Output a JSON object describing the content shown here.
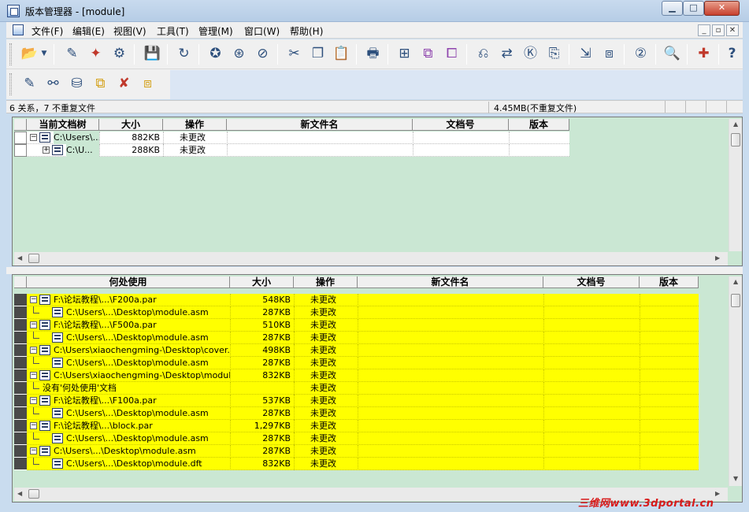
{
  "window": {
    "title": "版本管理器 - [module]"
  },
  "menu": [
    "文件(F)",
    "编辑(E)",
    "视图(V)",
    "工具(T)",
    "管理(M)",
    "窗口(W)",
    "帮助(H)"
  ],
  "status": {
    "left": "6 关系，7 不重复文件",
    "right": "4.45MB(不重复文件)"
  },
  "top_table": {
    "headers": [
      "当前文档树",
      "大小",
      "操作",
      "新文件名",
      "文档号",
      "版本"
    ],
    "rows": [
      {
        "name": "C:\\Users\\...",
        "size": "882KB",
        "action": "未更改",
        "level": 0,
        "expand": "⊟"
      },
      {
        "name": "C:\\U...",
        "size": "288KB",
        "action": "未更改",
        "level": 1,
        "expand": "⊞"
      }
    ]
  },
  "bottom_table": {
    "headers": [
      "何处使用",
      "大小",
      "操作",
      "新文件名",
      "文档号",
      "版本"
    ],
    "rows": [
      {
        "name": "F:\\论坛教程\\...\\F200a.par",
        "size": "548KB",
        "action": "未更改",
        "level": 0
      },
      {
        "name": "C:\\Users\\...\\Desktop\\module.asm",
        "size": "287KB",
        "action": "未更改",
        "level": 1
      },
      {
        "name": "F:\\论坛教程\\...\\F500a.par",
        "size": "510KB",
        "action": "未更改",
        "level": 0
      },
      {
        "name": "C:\\Users\\...\\Desktop\\module.asm",
        "size": "287KB",
        "action": "未更改",
        "level": 1
      },
      {
        "name": "C:\\Users\\xiaochengming-\\Desktop\\cover.par",
        "size": "498KB",
        "action": "未更改",
        "level": 0
      },
      {
        "name": "C:\\Users\\...\\Desktop\\module.asm",
        "size": "287KB",
        "action": "未更改",
        "level": 1
      },
      {
        "name": "C:\\Users\\xiaochengming-\\Desktop\\module.dft",
        "size": "832KB",
        "action": "未更改",
        "level": 0
      },
      {
        "name": "没有'何处使用'文档",
        "size": "",
        "action": "未更改",
        "level": 1
      },
      {
        "name": "F:\\论坛教程\\...\\F100a.par",
        "size": "537KB",
        "action": "未更改",
        "level": 0
      },
      {
        "name": "C:\\Users\\...\\Desktop\\module.asm",
        "size": "287KB",
        "action": "未更改",
        "level": 1
      },
      {
        "name": "F:\\论坛教程\\...\\block.par",
        "size": "1,297KB",
        "action": "未更改",
        "level": 0
      },
      {
        "name": "C:\\Users\\...\\Desktop\\module.asm",
        "size": "287KB",
        "action": "未更改",
        "level": 1
      },
      {
        "name": "C:\\Users\\...\\Desktop\\module.asm",
        "size": "287KB",
        "action": "未更改",
        "level": 0
      },
      {
        "name": "C:\\Users\\...\\Desktop\\module.dft",
        "size": "832KB",
        "action": "未更改",
        "level": 1
      }
    ]
  },
  "watermark": "三维网www.3dportal.cn",
  "toolbar1_icons": [
    "open-folder-icon",
    "dropdown-arrow-icon",
    "edit-icon",
    "properties-icon",
    "settings-icon",
    "save-icon",
    "refresh-icon",
    "find-icon",
    "find-replace-icon",
    "undo-change-icon",
    "cut-icon",
    "copy-icon",
    "paste-icon",
    "print-icon",
    "tree-icon",
    "select-all-icon",
    "deselect-icon",
    "rename-icon",
    "replace-icon",
    "document-number-icon",
    "revision-icon",
    "move-icon",
    "copy-file-icon",
    "version-icon",
    "inspect-icon",
    "sync-icon",
    "help-icon"
  ],
  "toolbar2_icons": [
    "edit-tree-icon",
    "network-icon",
    "library-icon",
    "assembly-icon",
    "delete-link-icon",
    "update-link-icon"
  ]
}
